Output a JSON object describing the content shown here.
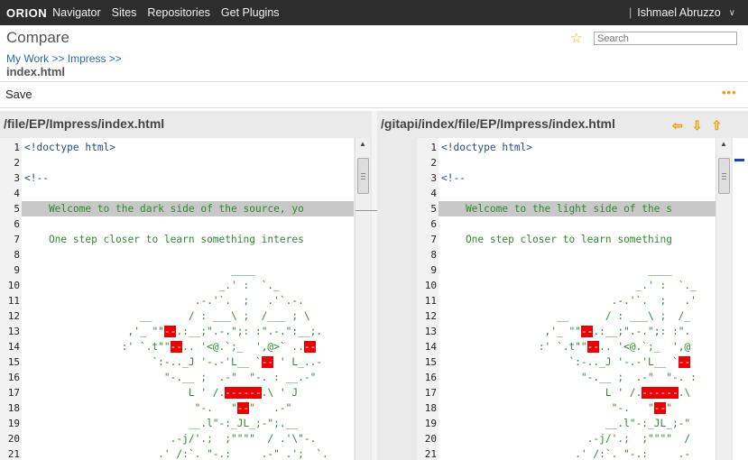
{
  "topbar": {
    "logo": "ORION",
    "nav": [
      "Navigator",
      "Sites",
      "Repositories",
      "Get Plugins"
    ],
    "user": "Ishmael Abruzzo"
  },
  "header": {
    "title": "Compare",
    "search_placeholder": "Search",
    "breadcrumb": "My Work >> Impress >>",
    "filename": "index.html"
  },
  "toolbar": {
    "save_label": "Save",
    "more_label": "•••"
  },
  "left": {
    "path": "/file/EP/Impress/index.html",
    "lines": [
      {
        "n": "1",
        "t": "<!doctype html>",
        "kind": "tag"
      },
      {
        "n": "2",
        "t": "",
        "kind": "tag"
      },
      {
        "n": "3",
        "t": "<!--",
        "kind": "tag"
      },
      {
        "n": "4",
        "t": "",
        "kind": "tag"
      },
      {
        "n": "5",
        "t": "    Welcome to the dark side of the source, yo",
        "kind": "hl"
      },
      {
        "n": "6",
        "t": "",
        "kind": "code"
      },
      {
        "n": "7",
        "t": "    One step closer to learn something interes",
        "kind": "code"
      },
      {
        "n": "8",
        "t": "",
        "kind": "code"
      },
      {
        "n": "9",
        "t": "                                  ____",
        "kind": "code"
      },
      {
        "n": "10",
        "t": "                                _.' :  `._",
        "kind": "code"
      },
      {
        "n": "11",
        "t": "                            .-.'`.  ;   .'`.-.",
        "kind": "code"
      },
      {
        "n": "12",
        "t": "                   __      / : ___\\ ;  /___ ; \\",
        "kind": "code"
      },
      {
        "n": "13",
        "t": "                 ,'_ \"\"--.:__;\".-.\";: :\".-.\":__;.",
        "kind": "code"
      },
      {
        "n": "14",
        "t": "                :' `.t\"\"--.. '<@.`;_  ',@>` ..--",
        "kind": "code"
      },
      {
        "n": "15",
        "t": "                     `:-.._J '-.-'L__ `-- ' L_..-",
        "kind": "code"
      },
      {
        "n": "16",
        "t": "                       \"-.__ ;  .-\"  \"-. : __.-\"",
        "kind": "code"
      },
      {
        "n": "17",
        "t": "                           L ' /.------.\\ ' J",
        "kind": "code"
      },
      {
        "n": "18",
        "t": "                            \"-.   \"--\"   .-\"",
        "kind": "code"
      },
      {
        "n": "19",
        "t": "                           __.l\"-:_JL_;-\";.__",
        "kind": "code"
      },
      {
        "n": "20",
        "t": "                        .-j/'.;  ;\"\"\"\"  / .'\\\"-.",
        "kind": "code"
      },
      {
        "n": "21",
        "t": "                      .' /:`. \"-.:     .-\" .';  `.",
        "kind": "code"
      }
    ]
  },
  "right": {
    "path": "/gitapi/index/file/EP/Impress/index.html",
    "lines": [
      {
        "n": "1",
        "t": "<!doctype html>",
        "kind": "tag"
      },
      {
        "n": "2",
        "t": "",
        "kind": "tag"
      },
      {
        "n": "3",
        "t": "<!--",
        "kind": "tag"
      },
      {
        "n": "4",
        "t": "",
        "kind": "tag"
      },
      {
        "n": "5",
        "t": "    Welcome to the light side of the s",
        "kind": "hl"
      },
      {
        "n": "6",
        "t": "",
        "kind": "code"
      },
      {
        "n": "7",
        "t": "    One step closer to learn something",
        "kind": "code"
      },
      {
        "n": "8",
        "t": "",
        "kind": "code"
      },
      {
        "n": "9",
        "t": "                                  ____",
        "kind": "code"
      },
      {
        "n": "10",
        "t": "                                _.' :  `._",
        "kind": "code"
      },
      {
        "n": "11",
        "t": "                            .-.'`.  ;   .'",
        "kind": "code"
      },
      {
        "n": "12",
        "t": "                   __      / : ___\\ ;  /_",
        "kind": "code"
      },
      {
        "n": "13",
        "t": "                 ,'_ \"\"--.:__;\".-.\";: :\".",
        "kind": "code"
      },
      {
        "n": "14",
        "t": "                :' `.t\"\"--.. '<@.`;_  ',@",
        "kind": "code"
      },
      {
        "n": "15",
        "t": "                     `:-.._J '-.-'L__ `--",
        "kind": "code"
      },
      {
        "n": "16",
        "t": "                       \"-.__ ;  .-\"  \"-. :",
        "kind": "code"
      },
      {
        "n": "17",
        "t": "                           L ' /.------.\\",
        "kind": "code"
      },
      {
        "n": "18",
        "t": "                            \"-.   \"--\"",
        "kind": "code"
      },
      {
        "n": "19",
        "t": "                           __.l\"-:_JL_;-\"",
        "kind": "code"
      },
      {
        "n": "20",
        "t": "                        .-j/'.;  ;\"\"\"\"  /",
        "kind": "code"
      },
      {
        "n": "21",
        "t": "                      .' /:`. \"-.:     .-",
        "kind": "code"
      }
    ]
  },
  "colors": {
    "accent": "#f0a000",
    "topbar": "#2d2d2d",
    "link": "#3068b0",
    "diff_red": "#e00000"
  }
}
